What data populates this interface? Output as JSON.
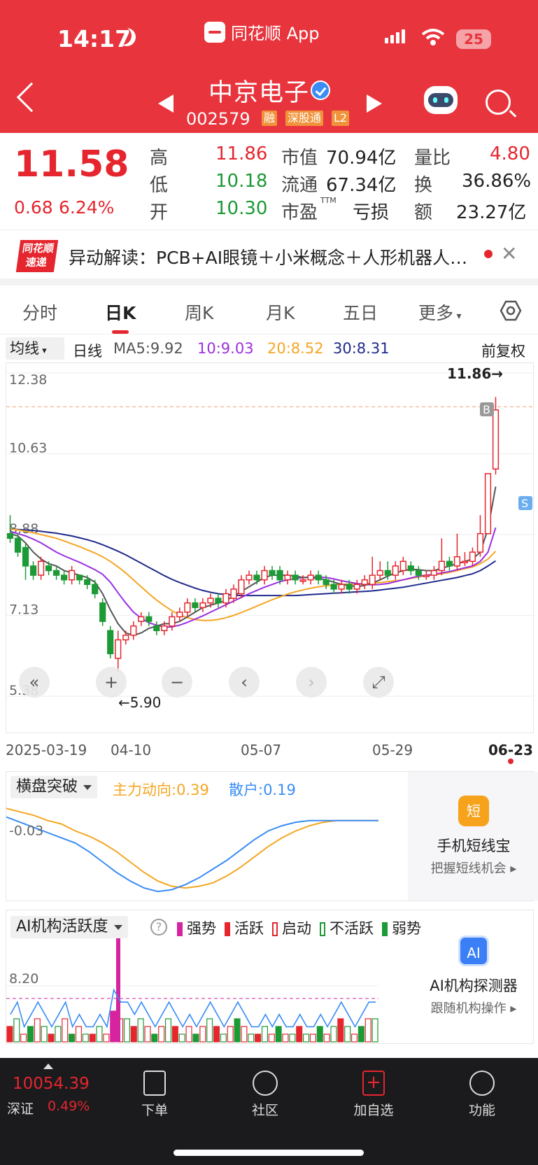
{
  "status": {
    "time": "14:17",
    "app_name": "同花顺 App",
    "battery": "25"
  },
  "stock": {
    "name": "中京电子",
    "code": "002579",
    "tags": [
      "融",
      "深股通",
      "L2"
    ]
  },
  "quote": {
    "price": "11.58",
    "change": "0.68",
    "change_pct": "6.24%",
    "high_label": "高",
    "high": "11.86",
    "low_label": "低",
    "low": "10.18",
    "open_label": "开",
    "open": "10.30",
    "mcap_label": "市值",
    "mcap": "70.94亿",
    "float_label": "流通",
    "float": "67.34亿",
    "pe_label": "市盈",
    "pe_sup": "TTM",
    "pe": "亏损",
    "vr_label": "量比",
    "vr": "4.80",
    "turnover_label": "换",
    "turnover": "36.86%",
    "amount_label": "额",
    "amount": "23.27亿"
  },
  "news": {
    "logo_line1": "同花顺",
    "logo_line2": "速递",
    "text": "异动解读：PCB+AI眼镜＋小米概念＋人形机器人概念"
  },
  "tabs": [
    "分时",
    "日K",
    "周K",
    "月K",
    "五日",
    "更多"
  ],
  "active_tab": "日K",
  "ma_row": {
    "button": "均线",
    "period": "日线",
    "ma5": "MA5:9.92",
    "ma10": "10:9.03",
    "ma20": "20:8.52",
    "ma30": "30:8.31",
    "adjust": "前复权"
  },
  "colors": {
    "up": "#e5262e",
    "down": "#1c9a36",
    "ma5": "#555555",
    "ma10": "#9b30e0",
    "ma20": "#f5a623",
    "ma30": "#1f2a8a"
  },
  "chart_data": {
    "type": "candlestick",
    "y_ticks": [
      "12.38",
      "10.63",
      "8.88",
      "7.13",
      "5.38"
    ],
    "ylim": [
      5.38,
      12.38
    ],
    "x_labels": [
      "2025-03-19",
      "04-10",
      "05-07",
      "05-29",
      "06-23"
    ],
    "max_label": "11.86→",
    "min_label": "←5.90",
    "candles": [
      {
        "o": 8.9,
        "c": 8.8,
        "h": 9.3,
        "l": 8.7
      },
      {
        "o": 8.8,
        "c": 8.5,
        "h": 8.9,
        "l": 8.4
      },
      {
        "o": 8.6,
        "c": 8.2,
        "h": 8.7,
        "l": 7.9
      },
      {
        "o": 8.2,
        "c": 8.0,
        "h": 8.3,
        "l": 7.9
      },
      {
        "o": 8.0,
        "c": 8.3,
        "h": 8.4,
        "l": 7.9
      },
      {
        "o": 8.2,
        "c": 8.1,
        "h": 8.3,
        "l": 8.0
      },
      {
        "o": 8.1,
        "c": 8.0,
        "h": 8.2,
        "l": 7.9
      },
      {
        "o": 8.0,
        "c": 7.9,
        "h": 8.1,
        "l": 7.8
      },
      {
        "o": 7.9,
        "c": 8.1,
        "h": 8.2,
        "l": 7.8
      },
      {
        "o": 8.0,
        "c": 7.9,
        "h": 8.0,
        "l": 7.8
      },
      {
        "o": 7.9,
        "c": 7.8,
        "h": 8.0,
        "l": 7.7
      },
      {
        "o": 7.8,
        "c": 7.6,
        "h": 7.9,
        "l": 7.5
      },
      {
        "o": 7.4,
        "c": 7.0,
        "h": 7.5,
        "l": 6.9
      },
      {
        "o": 6.8,
        "c": 6.3,
        "h": 6.9,
        "l": 6.2
      },
      {
        "o": 6.2,
        "c": 6.6,
        "h": 6.8,
        "l": 5.9
      },
      {
        "o": 6.6,
        "c": 6.7,
        "h": 6.8,
        "l": 6.5
      },
      {
        "o": 6.7,
        "c": 6.9,
        "h": 7.0,
        "l": 6.6
      },
      {
        "o": 7.0,
        "c": 7.1,
        "h": 7.2,
        "l": 6.9
      },
      {
        "o": 7.1,
        "c": 7.0,
        "h": 7.2,
        "l": 6.9
      },
      {
        "o": 6.9,
        "c": 6.8,
        "h": 7.0,
        "l": 6.7
      },
      {
        "o": 6.8,
        "c": 6.9,
        "h": 7.0,
        "l": 6.7
      },
      {
        "o": 6.9,
        "c": 7.1,
        "h": 7.2,
        "l": 6.8
      },
      {
        "o": 7.1,
        "c": 7.2,
        "h": 7.3,
        "l": 7.0
      },
      {
        "o": 7.2,
        "c": 7.4,
        "h": 7.5,
        "l": 7.1
      },
      {
        "o": 7.4,
        "c": 7.3,
        "h": 7.5,
        "l": 7.2
      },
      {
        "o": 7.3,
        "c": 7.4,
        "h": 7.5,
        "l": 7.2
      },
      {
        "o": 7.4,
        "c": 7.5,
        "h": 7.6,
        "l": 7.3
      },
      {
        "o": 7.5,
        "c": 7.4,
        "h": 7.6,
        "l": 7.3
      },
      {
        "o": 7.4,
        "c": 7.6,
        "h": 7.7,
        "l": 7.3
      },
      {
        "o": 7.5,
        "c": 7.7,
        "h": 7.8,
        "l": 7.4
      },
      {
        "o": 7.6,
        "c": 7.9,
        "h": 8.0,
        "l": 7.5
      },
      {
        "o": 7.9,
        "c": 8.0,
        "h": 8.1,
        "l": 7.8
      },
      {
        "o": 8.0,
        "c": 7.9,
        "h": 8.1,
        "l": 7.8
      },
      {
        "o": 7.9,
        "c": 8.1,
        "h": 8.2,
        "l": 7.8
      },
      {
        "o": 8.1,
        "c": 8.0,
        "h": 8.2,
        "l": 7.9
      },
      {
        "o": 8.1,
        "c": 7.9,
        "h": 8.2,
        "l": 7.8
      },
      {
        "o": 7.9,
        "c": 8.0,
        "h": 8.1,
        "l": 7.8
      },
      {
        "o": 8.0,
        "c": 7.9,
        "h": 8.1,
        "l": 7.8
      },
      {
        "o": 7.9,
        "c": 7.9,
        "h": 8.0,
        "l": 7.8
      },
      {
        "o": 7.9,
        "c": 8.0,
        "h": 8.1,
        "l": 7.8
      },
      {
        "o": 8.0,
        "c": 7.9,
        "h": 8.1,
        "l": 7.8
      },
      {
        "o": 7.9,
        "c": 7.8,
        "h": 8.0,
        "l": 7.7
      },
      {
        "o": 7.8,
        "c": 7.7,
        "h": 7.9,
        "l": 7.6
      },
      {
        "o": 7.7,
        "c": 7.8,
        "h": 7.9,
        "l": 7.6
      },
      {
        "o": 7.8,
        "c": 7.7,
        "h": 7.9,
        "l": 7.6
      },
      {
        "o": 7.7,
        "c": 7.8,
        "h": 7.9,
        "l": 7.6
      },
      {
        "o": 7.8,
        "c": 7.9,
        "h": 8.0,
        "l": 7.7
      },
      {
        "o": 7.8,
        "c": 8.0,
        "h": 8.4,
        "l": 7.7
      },
      {
        "o": 8.0,
        "c": 8.1,
        "h": 8.3,
        "l": 7.9
      },
      {
        "o": 8.1,
        "c": 8.0,
        "h": 8.3,
        "l": 7.9
      },
      {
        "o": 8.0,
        "c": 8.2,
        "h": 8.3,
        "l": 7.9
      },
      {
        "o": 8.1,
        "c": 8.3,
        "h": 8.4,
        "l": 8.0
      },
      {
        "o": 8.2,
        "c": 8.1,
        "h": 8.3,
        "l": 8.0
      },
      {
        "o": 8.1,
        "c": 8.0,
        "h": 8.2,
        "l": 7.9
      },
      {
        "o": 8.0,
        "c": 8.0,
        "h": 8.1,
        "l": 7.9
      },
      {
        "o": 8.0,
        "c": 8.1,
        "h": 8.2,
        "l": 7.9
      },
      {
        "o": 8.1,
        "c": 8.3,
        "h": 8.8,
        "l": 8.0
      },
      {
        "o": 8.3,
        "c": 8.2,
        "h": 8.4,
        "l": 8.1
      },
      {
        "o": 8.2,
        "c": 8.4,
        "h": 8.9,
        "l": 8.1
      },
      {
        "o": 8.3,
        "c": 8.3,
        "h": 8.5,
        "l": 8.2
      },
      {
        "o": 8.3,
        "c": 8.5,
        "h": 8.6,
        "l": 8.2
      },
      {
        "o": 8.5,
        "c": 8.9,
        "h": 9.3,
        "l": 8.4
      },
      {
        "o": 8.9,
        "c": 10.2,
        "h": 10.2,
        "l": 8.9
      },
      {
        "o": 10.3,
        "c": 11.58,
        "h": 11.86,
        "l": 10.18
      }
    ],
    "ma5": [
      8.9,
      8.85,
      8.7,
      8.5,
      8.35,
      8.25,
      8.2,
      8.1,
      8.05,
      8.0,
      7.95,
      7.85,
      7.6,
      7.25,
      6.95,
      6.75,
      6.7,
      6.75,
      6.85,
      6.9,
      6.95,
      6.95,
      7.0,
      7.1,
      7.2,
      7.3,
      7.35,
      7.4,
      7.45,
      7.55,
      7.65,
      7.75,
      7.85,
      7.95,
      8.0,
      8.0,
      8.0,
      7.98,
      7.95,
      7.95,
      7.93,
      7.9,
      7.85,
      7.8,
      7.78,
      7.75,
      7.78,
      7.83,
      7.9,
      7.98,
      8.05,
      8.1,
      8.13,
      8.12,
      8.1,
      8.1,
      8.15,
      8.2,
      8.25,
      8.3,
      8.35,
      8.5,
      9.0,
      9.92
    ],
    "ma10": [
      8.95,
      8.9,
      8.85,
      8.78,
      8.7,
      8.6,
      8.5,
      8.42,
      8.35,
      8.28,
      8.2,
      8.12,
      8.02,
      7.85,
      7.62,
      7.4,
      7.2,
      7.07,
      6.97,
      6.92,
      6.88,
      6.88,
      6.92,
      6.98,
      7.05,
      7.12,
      7.2,
      7.28,
      7.36,
      7.44,
      7.52,
      7.6,
      7.67,
      7.74,
      7.8,
      7.86,
      7.9,
      7.93,
      7.95,
      7.96,
      7.96,
      7.95,
      7.92,
      7.88,
      7.85,
      7.82,
      7.8,
      7.79,
      7.8,
      7.82,
      7.86,
      7.9,
      7.94,
      7.98,
      8.0,
      8.02,
      8.05,
      8.08,
      8.12,
      8.16,
      8.2,
      8.3,
      8.5,
      9.03
    ],
    "ma20": [
      9.0,
      8.98,
      8.95,
      8.92,
      8.88,
      8.84,
      8.8,
      8.74,
      8.68,
      8.62,
      8.55,
      8.48,
      8.4,
      8.3,
      8.18,
      8.05,
      7.9,
      7.75,
      7.6,
      7.46,
      7.34,
      7.23,
      7.14,
      7.08,
      7.04,
      7.02,
      7.02,
      7.04,
      7.08,
      7.13,
      7.19,
      7.26,
      7.33,
      7.4,
      7.47,
      7.53,
      7.59,
      7.64,
      7.68,
      7.72,
      7.75,
      7.77,
      7.79,
      7.8,
      7.81,
      7.81,
      7.82,
      7.83,
      7.84,
      7.86,
      7.88,
      7.9,
      7.93,
      7.96,
      7.99,
      8.01,
      8.03,
      8.06,
      8.1,
      8.14,
      8.18,
      8.25,
      8.35,
      8.52
    ],
    "ma30": [
      9.0,
      8.99,
      8.98,
      8.97,
      8.95,
      8.93,
      8.91,
      8.88,
      8.85,
      8.81,
      8.77,
      8.72,
      8.66,
      8.59,
      8.52,
      8.44,
      8.35,
      8.26,
      8.17,
      8.08,
      7.99,
      7.91,
      7.84,
      7.78,
      7.72,
      7.67,
      7.63,
      7.6,
      7.58,
      7.57,
      7.56,
      7.56,
      7.56,
      7.56,
      7.56,
      7.56,
      7.56,
      7.56,
      7.57,
      7.58,
      7.59,
      7.6,
      7.61,
      7.62,
      7.63,
      7.64,
      7.65,
      7.66,
      7.68,
      7.7,
      7.72,
      7.74,
      7.77,
      7.8,
      7.83,
      7.86,
      7.89,
      7.92,
      7.95,
      7.99,
      8.03,
      8.1,
      8.2,
      8.31
    ]
  },
  "chart_tools": [
    "«",
    "+",
    "−",
    "‹",
    "›",
    "⤢"
  ],
  "sub1": {
    "button": "横盘突破",
    "main_label": "主力动向:0.39",
    "retail_label": "散户:0.19",
    "y_tick": "-0.03",
    "main_series": [
      0.1,
      0.08,
      0.06,
      0.03,
      0.01,
      -0.03,
      -0.06,
      -0.1,
      -0.15,
      -0.21,
      -0.27,
      -0.32,
      -0.35,
      -0.36,
      -0.35,
      -0.33,
      -0.29,
      -0.24,
      -0.18,
      -0.12,
      -0.07,
      -0.03,
      0.0,
      0.02,
      0.03,
      0.03,
      0.03,
      0.03
    ],
    "retail_series": [
      0.05,
      0.02,
      -0.01,
      -0.04,
      -0.07,
      -0.1,
      -0.15,
      -0.21,
      -0.27,
      -0.32,
      -0.36,
      -0.38,
      -0.37,
      -0.34,
      -0.3,
      -0.25,
      -0.2,
      -0.14,
      -0.08,
      -0.03,
      0.0,
      0.02,
      0.03,
      0.03,
      0.03,
      0.03,
      0.03,
      0.03
    ]
  },
  "side1": {
    "icon_text": "短",
    "title": "手机短线宝",
    "sub": "把握短线机会 ▸"
  },
  "sub2": {
    "button": "AI机构活跃度",
    "legend": [
      "强势",
      "活跃",
      "启动",
      "不活跃",
      "弱势"
    ],
    "y_tick": "8.20",
    "bars": [
      2,
      3,
      1,
      2,
      3,
      2,
      1,
      2,
      3,
      1,
      2,
      1,
      1,
      2,
      1,
      4,
      3,
      3,
      2,
      3,
      2,
      1,
      2,
      3,
      2,
      1,
      2,
      1,
      2,
      3,
      2,
      1,
      2,
      3,
      2,
      1,
      1,
      2,
      1,
      2,
      1,
      1,
      2,
      1,
      1,
      2,
      1,
      2,
      3,
      2,
      1,
      2,
      3,
      3
    ]
  },
  "side2": {
    "icon_text": "AI",
    "title": "AI机构探测器",
    "sub": "跟随机构操作 ▸"
  },
  "footer": {
    "index_value": "10054.39",
    "index_name": "深证",
    "index_change": "0.49%",
    "items": [
      "下单",
      "社区",
      "加自选",
      "功能"
    ]
  }
}
